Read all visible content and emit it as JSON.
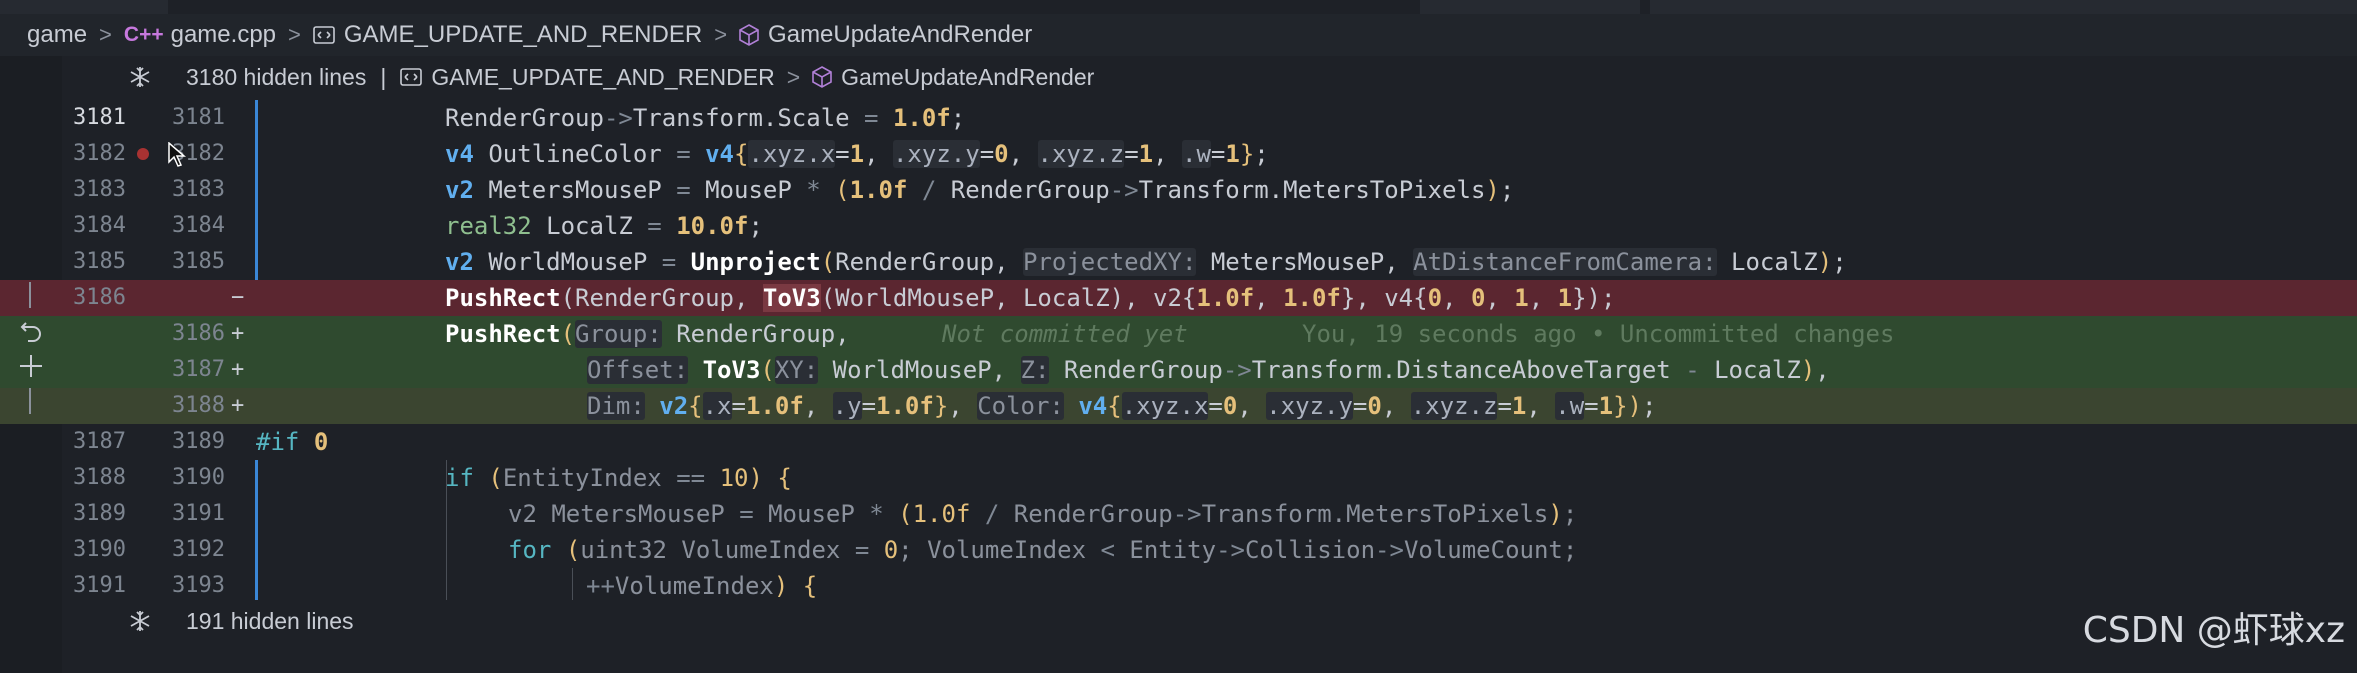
{
  "breadcrumb": {
    "items": [
      "game",
      "game.cpp",
      "GAME_UPDATE_AND_RENDER",
      "GameUpdateAndRender"
    ],
    "cpp_icon": "C++"
  },
  "hidden_top": {
    "text": "3180 hidden lines",
    "sep": "|",
    "crumb1": "GAME_UPDATE_AND_RENDER",
    "crumb2": "GameUpdateAndRender"
  },
  "hidden_bottom": {
    "text": "191 hidden lines"
  },
  "lines": {
    "l1": {
      "a": "3181",
      "b": "3181"
    },
    "l2": {
      "a": "3182",
      "b": "3182"
    },
    "l3": {
      "a": "3183",
      "b": "3183"
    },
    "l4": {
      "a": "3184",
      "b": "3184"
    },
    "l5": {
      "a": "3185",
      "b": "3185"
    },
    "l6": {
      "a": "3186",
      "b": "",
      "marker": "−"
    },
    "l7": {
      "a": "",
      "b": "3186",
      "marker": "+"
    },
    "l8": {
      "a": "",
      "b": "3187",
      "marker": "+"
    },
    "l9": {
      "a": "",
      "b": "3188",
      "marker": "+"
    },
    "l10": {
      "a": "3187",
      "b": "3189"
    },
    "l11": {
      "a": "3188",
      "b": "3190"
    },
    "l12": {
      "a": "3189",
      "b": "3191"
    },
    "l13": {
      "a": "3190",
      "b": "3192"
    },
    "l14": {
      "a": "3191",
      "b": "3193"
    }
  },
  "blame": {
    "status": "Not committed yet",
    "detail": "You, 19 seconds ago • Uncommitted changes"
  },
  "watermark": "CSDN @虾球xz",
  "icons": {
    "fold": "fold-icon",
    "cpp": "cpp-file-icon",
    "symbol": "symbol-namespace-icon",
    "method": "method-icon",
    "revert": "revert-icon",
    "stage": "stage-icon",
    "breakpoint": "breakpoint-icon",
    "cursor": "mouse-cursor-icon"
  },
  "colors": {
    "deleted": "#5b2630",
    "added": "#2f4a2f",
    "accent": "#3b87d6",
    "keyword": "#61afef"
  }
}
